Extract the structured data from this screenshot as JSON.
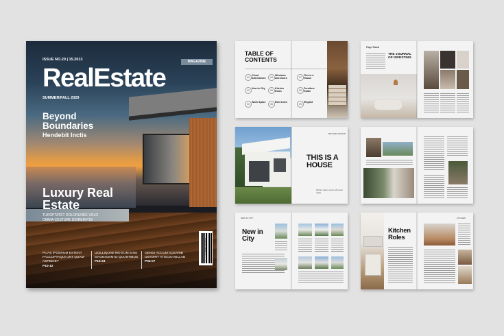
{
  "cover": {
    "issue": "ISSUE NO.20 | 15.2013",
    "magazine_tag": "MAGAZINE",
    "title": "RealEstate",
    "season": "SUMMER/FALL 2029",
    "headline": "Beyond Boundaries",
    "subline": "Hendebit Inctis",
    "feature": "Luxury Real Estate",
    "teaser_line1": "TUROPTATET DOLORUNDE VOLO",
    "teaser_line2": "OMNIA CESTURE DIOREM P29",
    "col1_text": "PLIAS IPOERUM ESTENT FACCUPTAQUI UNT QUAM ASPEDIET",
    "col1_page": "P10-12",
    "col2_text": "UCILLIQUAE MO EUM EINS MAGNISSIM ID QUUNTIBUS",
    "col2_page": "P15-23",
    "col3_text": "GENDI ACCUM ACEARIB USTORIT ATISCIO MILLAB",
    "col3_page": "P04-07",
    "barcode_number": "4 018133 007"
  },
  "toc": {
    "title": "TABLE OF CONTENTS",
    "items": [
      {
        "num": "01",
        "label": "Cloud Alternatives"
      },
      {
        "num": "02",
        "label": "New to City"
      },
      {
        "num": "03",
        "label": "Work Space"
      },
      {
        "num": "04",
        "label": "Windows and Doors"
      },
      {
        "num": "05",
        "label": "Kitchen Roles"
      },
      {
        "num": "06",
        "label": "Best Lines"
      },
      {
        "num": "07",
        "label": "This is a House"
      },
      {
        "num": "08",
        "label": "Furniture Guide"
      },
      {
        "num": "09",
        "label": "Elegant"
      }
    ]
  },
  "journal": {
    "title": "THE JOURNAL OF INVESTING",
    "label": "Page Stand"
  },
  "house": {
    "title": "THIS IS A HOUSE",
    "subtitle": "Ortium etiam verum ab rerum quibe",
    "tag": "BEYOND DESIGN"
  },
  "newcity": {
    "title": "New in City",
    "tag": "NEW IN CITY"
  },
  "kitchen": {
    "title": "Kitchen Roles",
    "tag": "KITCHEN"
  },
  "colors": {
    "background": "#e2e2e2",
    "page": "#f3f3f3",
    "cover_dark": "#1a1c22",
    "magazine_tag": "#7a8c9c"
  }
}
